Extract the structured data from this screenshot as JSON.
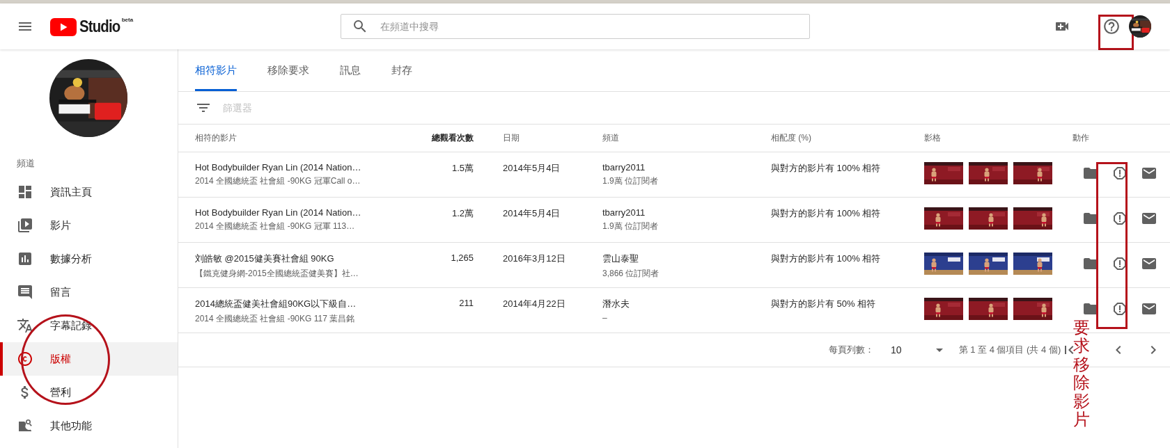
{
  "header": {
    "logo_text": "Studio",
    "logo_badge": "beta",
    "search": {
      "placeholder": "在頻道中搜尋"
    }
  },
  "sidebar": {
    "section_label": "頻道",
    "items": [
      {
        "label": "資訊主頁",
        "selected": false
      },
      {
        "label": "影片",
        "selected": false
      },
      {
        "label": "數據分析",
        "selected": false
      },
      {
        "label": "留言",
        "selected": false
      },
      {
        "label": "字幕記錄",
        "selected": false
      },
      {
        "label": "版權",
        "selected": true
      },
      {
        "label": "營利",
        "selected": false
      },
      {
        "label": "其他功能",
        "selected": false
      }
    ]
  },
  "tabs": [
    {
      "label": "相符影片",
      "selected": true
    },
    {
      "label": "移除要求",
      "selected": false
    },
    {
      "label": "訊息",
      "selected": false
    },
    {
      "label": "封存",
      "selected": false
    }
  ],
  "filter": {
    "placeholder": "篩選器"
  },
  "table": {
    "columns": [
      "相符的影片",
      "總觀看次數",
      "日期",
      "頻道",
      "相配度 (%)",
      "影格",
      "動作"
    ],
    "rows": [
      {
        "title": "Hot Bodybuilder Ryan Lin (2014 Nation…",
        "subtitle": "2014 全國總統盃 社會組 -90KG 冠軍Call o…",
        "views": "1.5萬",
        "date": "2014年5月4日",
        "channel": "tbarry2011",
        "subscribers": "1.9萬 位訂閱者",
        "match": "與對方的影片有 100% 相符"
      },
      {
        "title": "Hot Bodybuilder Ryan Lin (2014 Nation…",
        "subtitle": "2014 全國總統盃 社會組 -90KG 冠軍 113…",
        "views": "1.2萬",
        "date": "2014年5月4日",
        "channel": "tbarry2011",
        "subscribers": "1.9萬 位訂閱者",
        "match": "與對方的影片有 100% 相符"
      },
      {
        "title": "刘皓敏 @2015健美賽社會組 90KG",
        "subtitle": "【鐵克健身網-2015全國總統盃健美賽】社…",
        "views": "1,265",
        "date": "2016年3月12日",
        "channel": "雲山泰聖",
        "subscribers": "3,866 位訂閱者",
        "match": "與對方的影片有 100% 相符"
      },
      {
        "title": "2014總統盃健美社會組90KG以下級自…",
        "subtitle": "2014 全國總統盃 社會組 -90KG 117 葉昌銘",
        "views": "211",
        "date": "2014年4月22日",
        "channel": "潛水夫",
        "subscribers": "–",
        "match": "與對方的影片有 50% 相符"
      }
    ]
  },
  "pagination": {
    "rows_per_page_label": "每頁列數：",
    "rows_per_page": "10",
    "range": "第 1 至 4 個項目 (共 4 個)"
  },
  "annotations": {
    "note": "要求移除影片"
  }
}
